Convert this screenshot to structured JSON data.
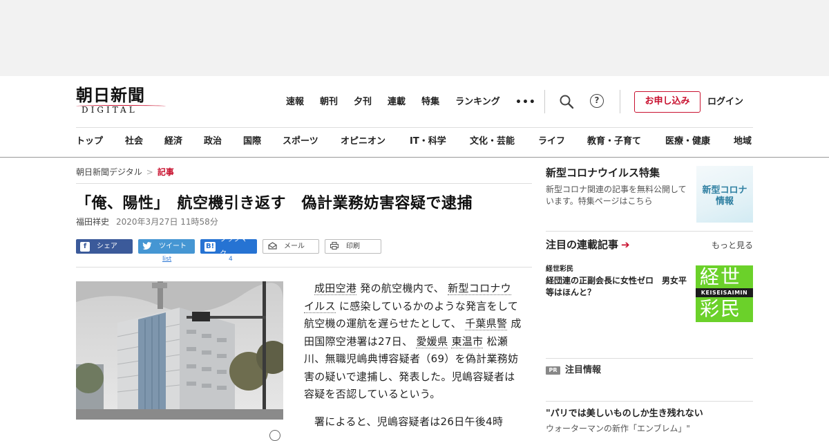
{
  "header": {
    "logo_main": "朝日新聞",
    "logo_sub": "DIGITAL",
    "top_nav": [
      "速報",
      "朝刊",
      "夕刊",
      "連載",
      "特集",
      "ランキング"
    ],
    "more": "•••",
    "help": "?",
    "apply_label": "お申し込み",
    "login_label": "ログイン",
    "category_nav": [
      "トップ",
      "社会",
      "経済",
      "政治",
      "国際",
      "スポーツ",
      "オピニオン",
      "IT・科学",
      "文化・芸能",
      "ライフ",
      "教育・子育て",
      "医療・健康",
      "地域"
    ]
  },
  "breadcrumb": {
    "home": "朝日新聞デジタル",
    "sep": ">",
    "current": "記事"
  },
  "article": {
    "headline": "「俺、陽性」　航空機引き返す　偽計業務妨害容疑で逮捕",
    "author": "福田祥史",
    "date": "2020年3月27日 11時58分",
    "paragraph1": {
      "k1": "成田空港",
      "t1": "発の航空機内で、",
      "k2": "新型コロナウイルス",
      "t2": "に感染しているかのような発言をして航空機の運航を遅らせたとして、",
      "k3": "千葉県警",
      "t3": "成田国際空港署は27日、",
      "k4": "愛媛県",
      "k5": "東温市",
      "t4": "松瀬川、無職児嶋典博容疑者（69）を偽計業務妨害の疑いで逮捕し、発表した。児嶋容疑者は容疑を否認しているという。"
    },
    "paragraph2": "署によると、児嶋容疑者は26日午後4時"
  },
  "share": {
    "facebook": "シェア",
    "twitter": "ツイート",
    "twitter_count": "list",
    "hatena": "ブックマーク",
    "hatena_icon": "B!",
    "hatena_count": "4",
    "mail": "メール",
    "print": "印刷"
  },
  "sidebar": {
    "corona_title": "新型コロナウイルス特集",
    "corona_desc": "新型コロナ関連の記事を無料公開しています。特集ページはこちら",
    "corona_thumb_text": [
      "新型コロナ",
      "情報"
    ],
    "serial_title": "注目の連載記事",
    "serial_arrow": "➔",
    "more_label": "もっと見る",
    "serial_kicker": "経世彩民",
    "serial_headline": "経団連の正副会長に女性ゼロ　男女平等はほんと？",
    "serial_thumb": {
      "top": "経世",
      "mid": "KEISEISAIMIN",
      "bottom": "彩民"
    },
    "pr_badge": "PR",
    "pr_title": "注目情報",
    "pr_headline": "\"パリでは美しいものしか生き残れない",
    "pr_sub": "ウォーターマンの新作「エンブレム」\""
  },
  "colors": {
    "accent": "#c8102e",
    "facebook": "#3b5a9a",
    "twitter": "#4596d3",
    "hatena": "#2673d3",
    "serial_green": "#6bd12a"
  }
}
